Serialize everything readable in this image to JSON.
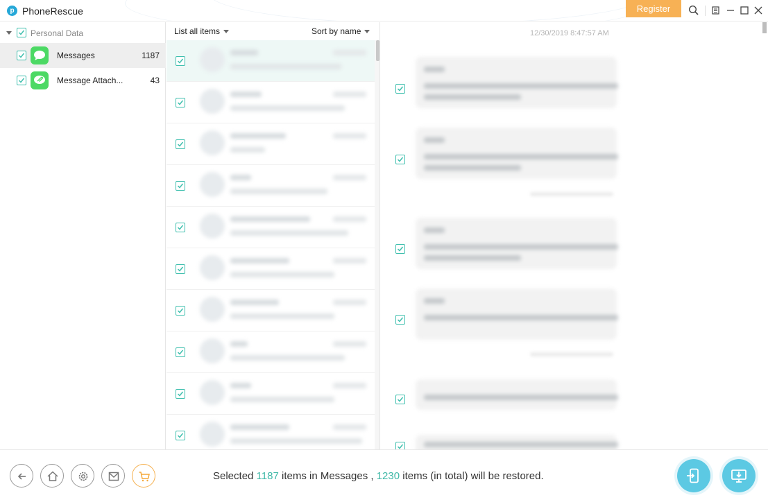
{
  "app": {
    "title": "PhoneRescue",
    "logo_letter": "p",
    "register_label": "Register",
    "accent_color": "#3fb8a7",
    "register_color": "#f7b155",
    "icons": [
      "search-icon",
      "menu-icon",
      "minimize-icon",
      "maximize-icon",
      "close-icon"
    ]
  },
  "sidebar": {
    "group_label": "Personal Data",
    "items": [
      {
        "label": "Messages",
        "count": "1187",
        "icon": "messages-icon"
      },
      {
        "label": "Message Attach...",
        "count": "43",
        "icon": "message-attachment-icon"
      }
    ]
  },
  "list": {
    "filter_label": "List all items",
    "sort_label": "Sort by name"
  },
  "detail": {
    "timestamp": "12/30/2019 8:47:57 AM"
  },
  "status": {
    "prefix": "Selected",
    "selected_count": "1187",
    "mid": "items in Messages ,",
    "total_count": "1230",
    "suffix": "items (in total) will be restored."
  },
  "bottom_icons": [
    "back-icon",
    "home-icon",
    "settings-icon",
    "mail-icon",
    "cart-icon",
    "to-device-icon",
    "to-computer-icon"
  ]
}
